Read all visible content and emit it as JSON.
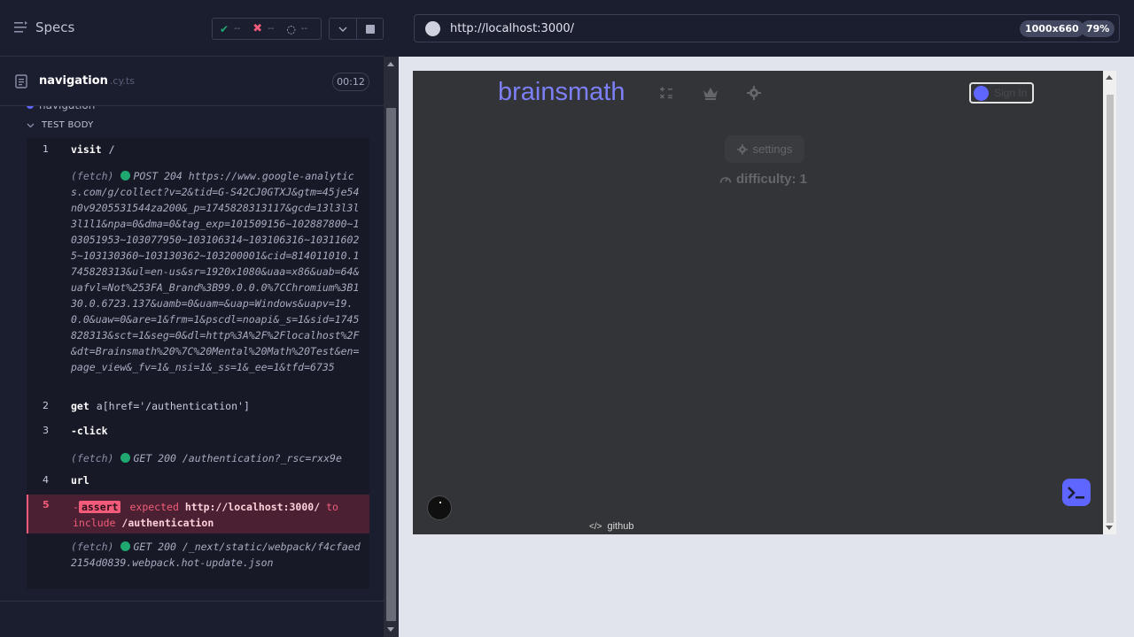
{
  "reporter": {
    "specs_label": "Specs",
    "stats": {
      "passed": "--",
      "failed": "--",
      "pending": "--"
    },
    "spec": {
      "name": "navigation",
      "ext": ".cy.ts",
      "duration": "00:12"
    },
    "suite_title": "navigation",
    "test_body_label": "TEST BODY",
    "commands": [
      {
        "num": "1",
        "name": "visit",
        "arg": "/"
      },
      {
        "fetch": "(fetch)",
        "text": "POST 204 https://www.google-analytics.com/g/collect?v=2&tid=G-S42CJ0GTXJ&gtm=45je54n0v9205531544za200&_p=1745828313117&gcd=13l3l3l3l1l1&npa=0&dma=0&tag_exp=101509156~102887800~103051953~103077950~103106314~103106316~103116025~103130360~103130362~103200001&cid=814011010.1745828313&ul=en-us&sr=1920x1080&uaa=x86&uab=64&uafvl=Not%253FA_Brand%3B99.0.0.0%7CChromium%3B130.0.6723.137&uamb=0&uam=&uap=Windows&uapv=19.0.0&uaw=0&are=1&frm=1&pscdl=noapi&_s=1&sid=1745828313&sct=1&seg=0&dl=http%3A%2F%2Flocalhost%2F&dt=Brainsmath%20%7C%20Mental%20Math%20Test&en=page_view&_fv=1&_nsi=1&_ss=1&_ee=1&tfd=6735"
      },
      {
        "num": "2",
        "name": "get",
        "arg": "a[href='/authentication']"
      },
      {
        "num": "3",
        "name": "-click"
      },
      {
        "fetch": "(fetch)",
        "text": "GET 200 /authentication?_rsc=rxx9e"
      },
      {
        "num": "4",
        "name": "url"
      },
      {
        "num": "5",
        "prefix": "-",
        "badge": "assert",
        "expected": "expected",
        "url": "http://localhost:3000/",
        "to": "to",
        "include": "include",
        "path": "/authentication"
      },
      {
        "fetch": "(fetch)",
        "text": "GET 200 /_next/static/webpack/f4cfaed2154d0839.webpack.hot-update.json"
      }
    ]
  },
  "aut": {
    "url": "http://localhost:3000/",
    "viewport": "1000x660",
    "zoom": "79%",
    "logo": "brainsmath",
    "signin": "Sign In",
    "settings": "settings",
    "difficulty": "difficulty: 1",
    "github": "github",
    "colors": {
      "accent": "#5f66ff",
      "bg": "#323437",
      "fail": "#f25c7a",
      "pass": "#1fa971"
    }
  }
}
